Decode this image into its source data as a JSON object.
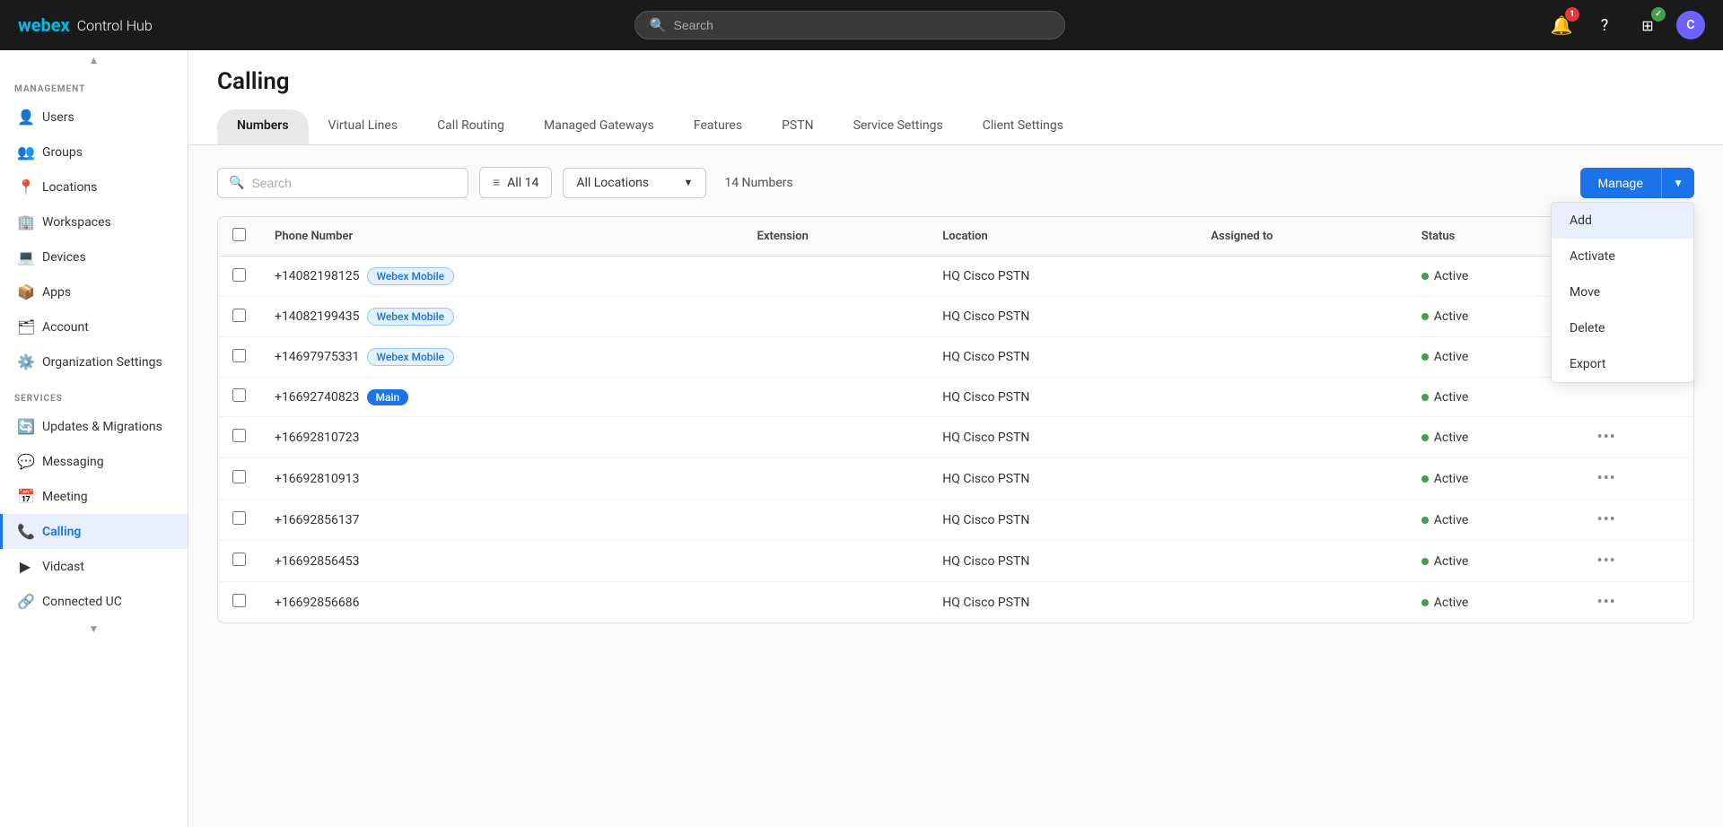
{
  "topnav": {
    "logo_webex": "webex",
    "logo_subtitle": "Control Hub",
    "search_placeholder": "Search",
    "notification_badge": "1",
    "avatar_label": "C"
  },
  "sidebar": {
    "management_label": "MANAGEMENT",
    "services_label": "SERVICES",
    "management_items": [
      {
        "id": "users",
        "label": "Users",
        "icon": "👤"
      },
      {
        "id": "groups",
        "label": "Groups",
        "icon": "👥"
      },
      {
        "id": "locations",
        "label": "Locations",
        "icon": "📍"
      },
      {
        "id": "workspaces",
        "label": "Workspaces",
        "icon": "🏢"
      },
      {
        "id": "devices",
        "label": "Devices",
        "icon": "💻"
      },
      {
        "id": "apps",
        "label": "Apps",
        "icon": "📦"
      },
      {
        "id": "account",
        "label": "Account",
        "icon": "🗂"
      },
      {
        "id": "org-settings",
        "label": "Organization Settings",
        "icon": "⚙️"
      }
    ],
    "service_items": [
      {
        "id": "updates",
        "label": "Updates & Migrations",
        "icon": "🔄"
      },
      {
        "id": "messaging",
        "label": "Messaging",
        "icon": "💬"
      },
      {
        "id": "meeting",
        "label": "Meeting",
        "icon": "📅"
      },
      {
        "id": "calling",
        "label": "Calling",
        "icon": "📞",
        "active": true
      },
      {
        "id": "vidcast",
        "label": "Vidcast",
        "icon": "▶"
      },
      {
        "id": "connected-uc",
        "label": "Connected UC",
        "icon": "🔗"
      }
    ]
  },
  "main": {
    "title": "Calling",
    "tabs": [
      {
        "id": "numbers",
        "label": "Numbers",
        "active": true
      },
      {
        "id": "virtual-lines",
        "label": "Virtual Lines"
      },
      {
        "id": "call-routing",
        "label": "Call Routing"
      },
      {
        "id": "managed-gateways",
        "label": "Managed Gateways"
      },
      {
        "id": "features",
        "label": "Features"
      },
      {
        "id": "pstn",
        "label": "PSTN"
      },
      {
        "id": "service-settings",
        "label": "Service Settings"
      },
      {
        "id": "client-settings",
        "label": "Client Settings"
      }
    ]
  },
  "toolbar": {
    "search_placeholder": "Search",
    "filter_label": "All 14",
    "location_label": "All Locations",
    "count_label": "14 Numbers",
    "manage_label": "Manage"
  },
  "dropdown": {
    "items": [
      {
        "id": "add",
        "label": "Add",
        "highlighted": true
      },
      {
        "id": "activate",
        "label": "Activate"
      },
      {
        "id": "move",
        "label": "Move"
      },
      {
        "id": "delete",
        "label": "Delete"
      },
      {
        "id": "export",
        "label": "Export"
      }
    ]
  },
  "table": {
    "columns": [
      {
        "id": "phone",
        "label": "Phone Number"
      },
      {
        "id": "extension",
        "label": "Extension"
      },
      {
        "id": "location",
        "label": "Location"
      },
      {
        "id": "assigned",
        "label": "Assigned to"
      },
      {
        "id": "status",
        "label": "Status"
      }
    ],
    "rows": [
      {
        "phone": "+14082198125",
        "badge": "Webex Mobile",
        "badge_type": "webex",
        "extension": "",
        "location": "HQ Cisco PSTN",
        "assigned": "",
        "status": "Active"
      },
      {
        "phone": "+14082199435",
        "badge": "Webex Mobile",
        "badge_type": "webex",
        "extension": "",
        "location": "HQ Cisco PSTN",
        "assigned": "",
        "status": "Active"
      },
      {
        "phone": "+14697975331",
        "badge": "Webex Mobile",
        "badge_type": "webex",
        "extension": "",
        "location": "HQ Cisco PSTN",
        "assigned": "",
        "status": "Active"
      },
      {
        "phone": "+16692740823",
        "badge": "Main",
        "badge_type": "main",
        "extension": "",
        "location": "HQ Cisco PSTN",
        "assigned": "",
        "status": "Active"
      },
      {
        "phone": "+16692810723",
        "badge": "",
        "badge_type": "",
        "extension": "",
        "location": "HQ Cisco PSTN",
        "assigned": "",
        "status": "Active"
      },
      {
        "phone": "+16692810913",
        "badge": "",
        "badge_type": "",
        "extension": "",
        "location": "HQ Cisco PSTN",
        "assigned": "",
        "status": "Active"
      },
      {
        "phone": "+16692856137",
        "badge": "",
        "badge_type": "",
        "extension": "",
        "location": "HQ Cisco PSTN",
        "assigned": "",
        "status": "Active"
      },
      {
        "phone": "+16692856453",
        "badge": "",
        "badge_type": "",
        "extension": "",
        "location": "HQ Cisco PSTN",
        "assigned": "",
        "status": "Active"
      },
      {
        "phone": "+16692856686",
        "badge": "",
        "badge_type": "",
        "extension": "",
        "location": "HQ Cisco PSTN",
        "assigned": "",
        "status": "Active"
      }
    ]
  }
}
